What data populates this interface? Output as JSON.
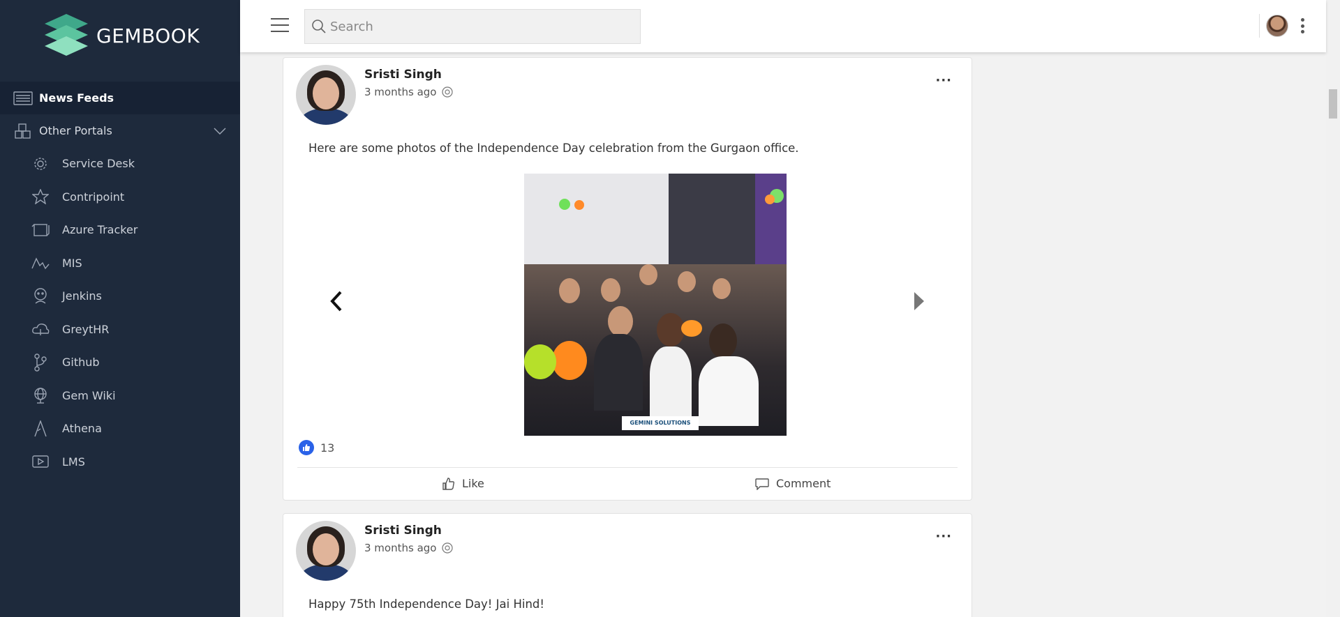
{
  "brand": {
    "name": "GEMBOOK"
  },
  "nav": {
    "news_feeds": "News Feeds",
    "other_portals": "Other Portals",
    "portals": [
      {
        "label": "Service Desk",
        "icon": "gear-icon"
      },
      {
        "label": "Contripoint",
        "icon": "star-icon"
      },
      {
        "label": "Azure Tracker",
        "icon": "tracker-icon"
      },
      {
        "label": "MIS",
        "icon": "chart-icon"
      },
      {
        "label": "Jenkins",
        "icon": "jenkins-icon"
      },
      {
        "label": "GreytHR",
        "icon": "cloud-icon"
      },
      {
        "label": "Github",
        "icon": "branch-icon"
      },
      {
        "label": "Gem Wiki",
        "icon": "globe-icon"
      },
      {
        "label": "Athena",
        "icon": "triangle-icon"
      },
      {
        "label": "LMS",
        "icon": "video-icon"
      }
    ]
  },
  "search": {
    "placeholder": "Search"
  },
  "posts": [
    {
      "author": "Sristi Singh",
      "time": "3 months ago",
      "text": "Here are some photos of the Independence Day celebration from the Gurgaon office.",
      "image_caption": "GEMINI SOLUTIONS",
      "likes": "13",
      "like_label": "Like",
      "comment_label": "Comment"
    },
    {
      "author": "Sristi Singh",
      "time": "3 months ago",
      "text": "Happy 75th Independence Day! Jai Hind!"
    }
  ],
  "colors": {
    "sidebar": "#1e2a3c",
    "accent": "#2a62e8"
  }
}
